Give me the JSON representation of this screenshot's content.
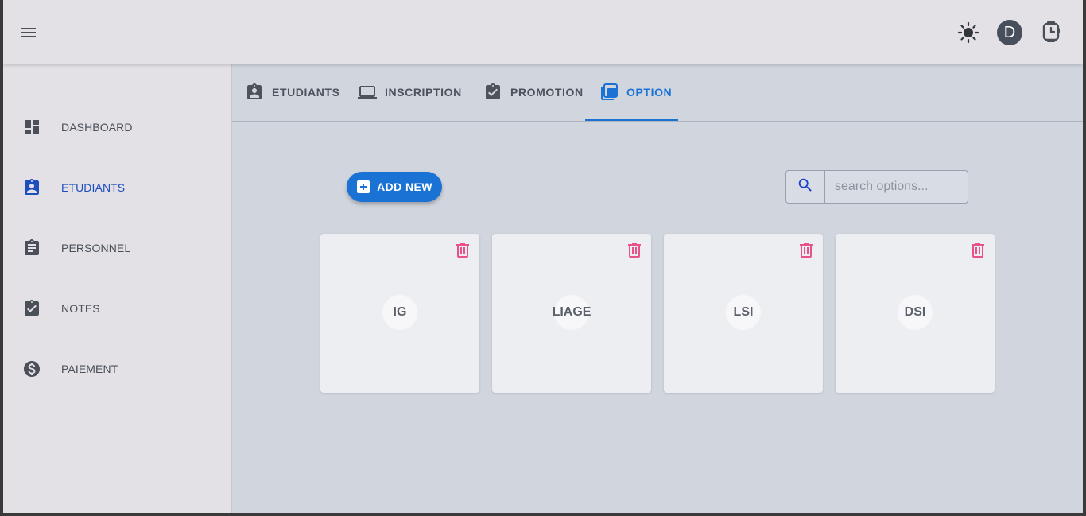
{
  "header": {
    "menu_icon": "menu-icon",
    "theme_icon": "sun-icon",
    "avatar_initial": "D",
    "watch_icon": "watch-icon"
  },
  "sidebar": {
    "items": [
      {
        "label": "DASHBOARD",
        "icon": "dashboard-icon",
        "active": false
      },
      {
        "label": "ETUDIANTS",
        "icon": "student-badge-icon",
        "active": true
      },
      {
        "label": "PERSONNEL",
        "icon": "clipboard-icon",
        "active": false
      },
      {
        "label": "NOTES",
        "icon": "clipboard-check-icon",
        "active": false
      },
      {
        "label": "PAIEMENT",
        "icon": "dollar-icon",
        "active": false
      }
    ]
  },
  "tabs": [
    {
      "label": "ETUDIANTS",
      "icon": "student-badge-icon",
      "active": false
    },
    {
      "label": "INSCRIPTION",
      "icon": "laptop-icon",
      "active": false
    },
    {
      "label": "PROMOTION",
      "icon": "clipboard-check-icon",
      "active": false
    },
    {
      "label": "OPTION",
      "icon": "library-icon",
      "active": true
    }
  ],
  "toolbar": {
    "add_label": "ADD NEW",
    "search_placeholder": "search options..."
  },
  "options": [
    {
      "label": "IG"
    },
    {
      "label": "LIAGE"
    },
    {
      "label": "LSI"
    },
    {
      "label": "DSI"
    }
  ],
  "colors": {
    "accent": "#1a73d4",
    "active_nav": "#1f4fbf",
    "delete": "#e8518a",
    "sidebar_bg": "#e3e0e6",
    "content_bg": "#d1d5de"
  }
}
